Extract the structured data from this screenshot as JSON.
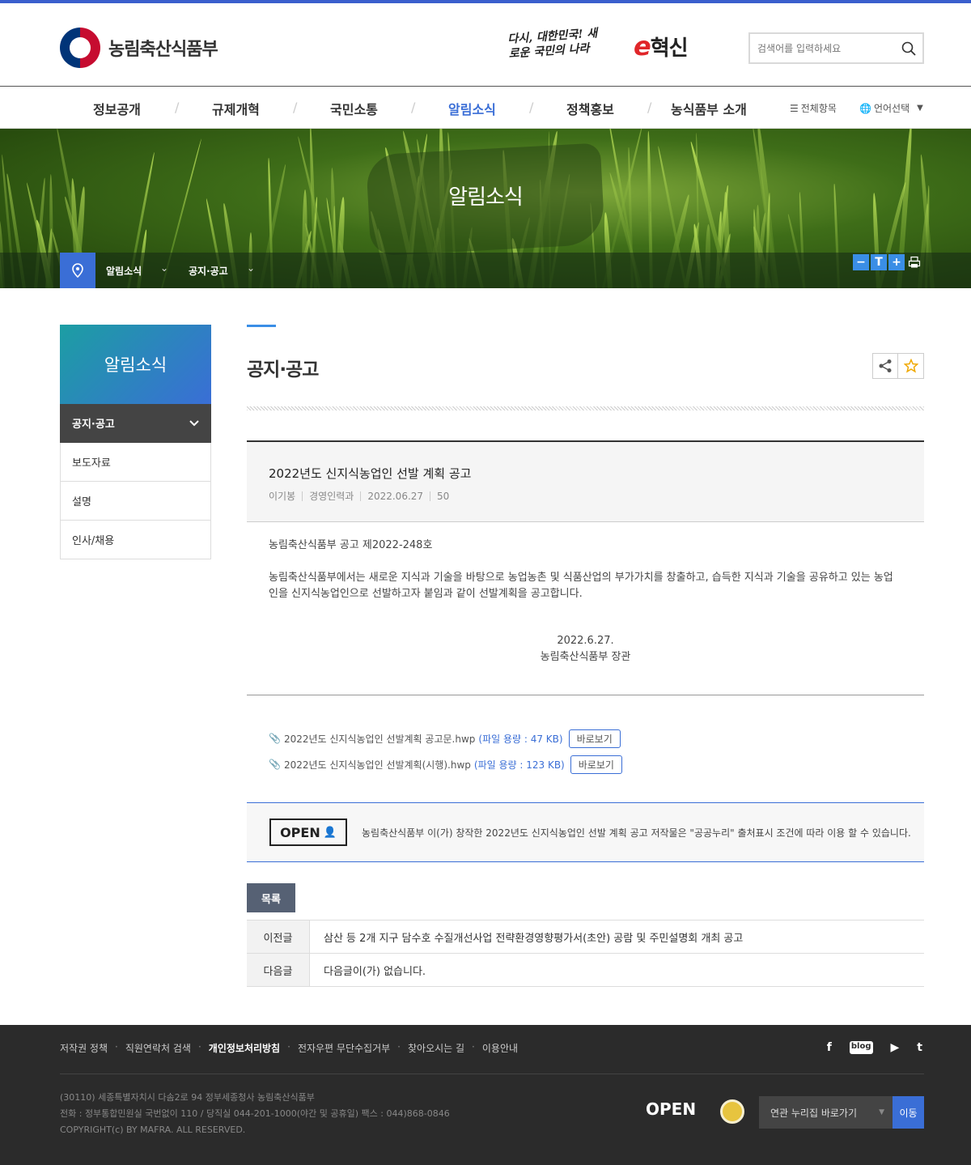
{
  "header": {
    "logo_text": "농림축산식품부",
    "slogan": "다시, 대한민국! 새로운 국민의 나라",
    "innovation_prefix": "e",
    "innovation": "혁신",
    "search_placeholder": "검색어를 입력하세요"
  },
  "gnb": {
    "items": [
      {
        "label": "정보공개"
      },
      {
        "label": "규제개혁"
      },
      {
        "label": "국민소통"
      },
      {
        "label": "알림소식"
      },
      {
        "label": "정책홍보"
      },
      {
        "label": "농식품부 소개"
      }
    ],
    "active": "알림소식",
    "all_menu": "전체항목",
    "language": "언어선택"
  },
  "visual": {
    "title": "알림소식",
    "breadcrumb": [
      "알림소식",
      "공지·공고"
    ],
    "tools": [
      "−",
      "T",
      "+"
    ]
  },
  "sidebar": {
    "title": "알림소식",
    "items": [
      {
        "label": "공지·공고"
      },
      {
        "label": "보도자료"
      },
      {
        "label": "설명"
      },
      {
        "label": "인사/채용"
      }
    ]
  },
  "content": {
    "page_title": "공지·공고",
    "post": {
      "title": "2022년도 신지식농업인 선발 계획 공고",
      "author": "이기봉",
      "department": "경영인력과",
      "date": "2022.06.27",
      "views": "50",
      "notice_no": "농림축산식품부 공고 제2022-248호",
      "body": "농림축산식품부에서는 새로운 지식과 기술을 바탕으로 농업농촌 및 식품산업의 부가가치를 창출하고, 습득한 지식과 기술을 공유하고 있는 농업인을 신지식농업인으로 선발하고자 붙임과 같이 선발계획을 공고합니다.",
      "sign_date": "2022.6.27.",
      "sign_name": "농림축산식품부 장관"
    },
    "files": [
      {
        "name": "2022년도 신지식농업인 선발계획 공고문.hwp",
        "size": "(파일 용량 : 47 KB)",
        "view": "바로보기"
      },
      {
        "name": "2022년도 신지식농업인 선발계획(시행).hwp",
        "size": "(파일 용량 : 123 KB)",
        "view": "바로보기"
      }
    ],
    "kogl": {
      "badge": "OPEN",
      "text": "농림축산식품부 이(가) 창작한 2022년도 신지식농업인 선발 계획 공고 저작물은 \"공공누리\" 출처표시 조건에 따라 이용 할 수 있습니다."
    },
    "list_button": "목록",
    "prev_label": "이전글",
    "prev_title": "삼산 등 2개 지구 담수호 수질개선사업 전략환경영향평가서(초안) 공람 및 주민설명회 개최 공고",
    "next_label": "다음글",
    "next_title": "다음글이(가) 없습니다."
  },
  "footer": {
    "links": [
      "저작권 정책",
      "직원연락처 검색",
      "개인정보처리방침",
      "전자우편 무단수집거부",
      "찾아오시는 길",
      "이용안내"
    ],
    "sns": [
      "f",
      "blog",
      "▶",
      "t"
    ],
    "address": "(30110) 세종특별자치시 다솜2로 94 정부세종청사 농림축산식품부",
    "phone": "전화 : 정부통합민원실 국번없이 110 / 당직실 044-201-1000(야간 및 공휴일)     팩스 : 044)868-0846",
    "copyright": "COPYRIGHT(c) BY MAFRA. ALL RESERVED.",
    "open_logo": "OPEN",
    "related_select": "연관 누리집 바로가기",
    "go_button": "이동"
  },
  "colors": {
    "accent": "#3a6ed6",
    "footer_bg": "#2b2b2b",
    "top_bar": "#3a5fcd"
  }
}
